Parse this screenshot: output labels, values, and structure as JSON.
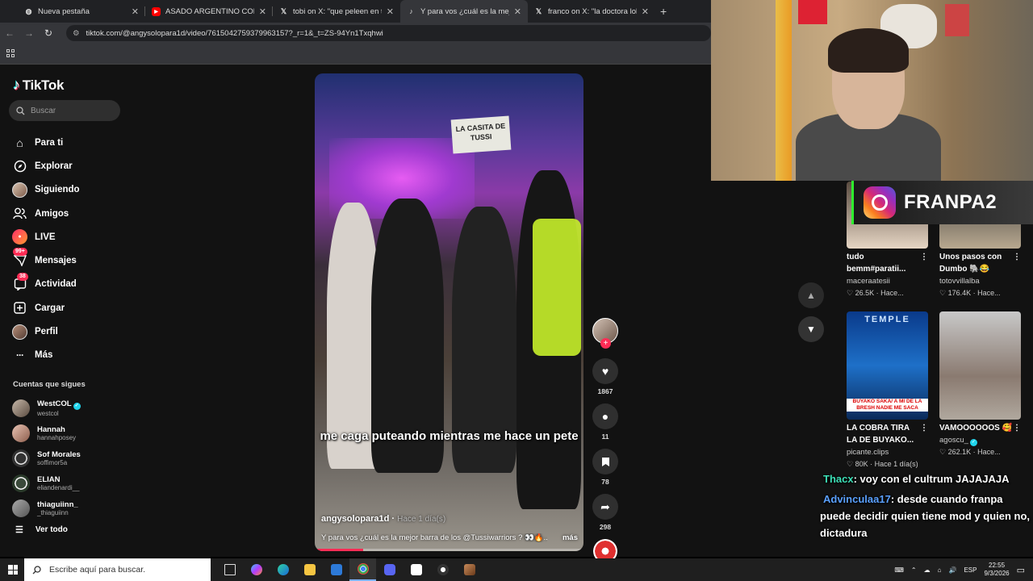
{
  "browser": {
    "tabs": [
      {
        "title": "Nueva pestaña",
        "icon": "globe-icon"
      },
      {
        "title": "ASADO ARGENTINO CON COSTILLAS",
        "icon": "youtube-icon"
      },
      {
        "title": "tobi on X: \"que peleen en tanga",
        "icon": "x-icon"
      },
      {
        "title": "Y para vos ¿cuál es la mejor barra",
        "icon": "tiktok-icon"
      },
      {
        "title": "franco on X: \"la doctora lola la",
        "icon": "x-icon"
      }
    ],
    "url": "tiktok.com/@angysolopara1d/video/7615042759379963157?_r=1&_t=ZS-94Yn1Txqhwi"
  },
  "sidebar": {
    "logo": "TikTok",
    "search_placeholder": "Buscar",
    "nav": [
      {
        "label": "Para ti",
        "icon": "home-icon"
      },
      {
        "label": "Explorar",
        "icon": "compass-icon"
      },
      {
        "label": "Siguiendo",
        "icon": "avatar-icon"
      },
      {
        "label": "Amigos",
        "icon": "friends-icon"
      },
      {
        "label": "LIVE",
        "icon": "live-icon"
      },
      {
        "label": "Mensajes",
        "icon": "message-icon",
        "badge": "99+"
      },
      {
        "label": "Actividad",
        "icon": "activity-icon",
        "badge": "38"
      },
      {
        "label": "Cargar",
        "icon": "upload-icon"
      },
      {
        "label": "Perfil",
        "icon": "profile-icon"
      },
      {
        "label": "Más",
        "icon": "more-icon"
      }
    ],
    "following_header": "Cuentas que sigues",
    "following": [
      {
        "name": "WestCOL",
        "user": "westcol",
        "verified": true
      },
      {
        "name": "Hannah",
        "user": "hannahposey"
      },
      {
        "name": "Sof Morales",
        "user": "soffimor5a"
      },
      {
        "name": "ELIAN",
        "user": "eliandenardi__"
      },
      {
        "name": "thiaguiinn_",
        "user": "_thiaguiinn"
      }
    ],
    "see_all": "Ver todo"
  },
  "video": {
    "sign": "LA CASITA DE TUSSI",
    "caption": "me caga puteando mientras me hace un pete",
    "author": "angysolopara1d",
    "time": "Hace 1 día(s)",
    "description": "Y para vos ¿cuál es la mejor barra de los @Tussiwarriors ? 👀🔥...",
    "more": "más",
    "progress": 0.18
  },
  "actions": {
    "likes": "1867",
    "comments": "11",
    "saves": "78",
    "shares": "298"
  },
  "recommended": [
    {
      "title": "tudo bemm#paratii...",
      "user": "maceraatesii",
      "stats": "26.5K · Hace..."
    },
    {
      "title": "Unos pasos con Dumbo 🐘😂",
      "user": "totovvillalba",
      "stats": "176.4K · Hace..."
    },
    {
      "title": "LA COBRA TIRA LA DE BUYAKO...",
      "user": "picante.clips",
      "stats": "80K · Hace 1 día(s)",
      "overlay": "BUYAKO SAKA/ A MI DE LA BRESH NADIE ME SACA"
    },
    {
      "title": "VAMOOOOOOS 🥰",
      "user": "agoscu_",
      "stats": "262.1K · Hace...",
      "verified": true
    }
  ],
  "overlay": {
    "instagram_handle": "FRANPA2",
    "chat": [
      {
        "user": "Thacx",
        "text": ": voy con el cultrum JAJAJAJA"
      },
      {
        "user": "Advinculaa17",
        "text": ": desde cuando franpa puede decidir quien tiene mod y quien no, dictadura"
      }
    ]
  },
  "taskbar": {
    "search_placeholder": "Escribe aquí para buscar.",
    "lang": "ESP",
    "time": "22:55",
    "date": "9/3/2026"
  },
  "colors": {
    "accent": "#fe2c55",
    "chat_user1": "#3de0b7",
    "chat_user2": "#5aa0ff",
    "vest": "#c6ef2a"
  }
}
